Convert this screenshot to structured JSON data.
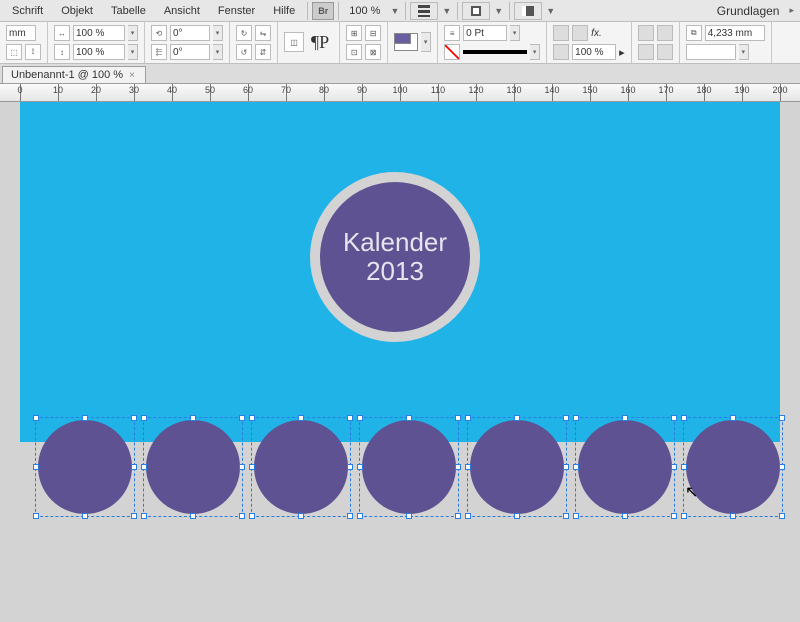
{
  "menu": {
    "items": [
      "Schrift",
      "Objekt",
      "Tabelle",
      "Ansicht",
      "Fenster",
      "Hilfe"
    ],
    "br": "Br",
    "zoom": "100 %",
    "workspace": "Grundlagen"
  },
  "opts": {
    "mm": "mm",
    "pct1": "100 %",
    "pct2": "100 %",
    "deg1": "0°",
    "deg2": "0°",
    "pt": "0 Pt",
    "pct3": "100 %",
    "dim": "4,233 mm",
    "fx": "fx."
  },
  "tab": {
    "title": "Unbenannt-1 @ 100 %"
  },
  "ruler": {
    "labels": [
      "0",
      "10",
      "20",
      "30",
      "40",
      "50",
      "60",
      "70",
      "80",
      "90",
      "100",
      "110",
      "120",
      "130",
      "140",
      "150",
      "160",
      "170",
      "180",
      "190",
      "200"
    ]
  },
  "art": {
    "title_l1": "Kalender",
    "title_l2": "2013"
  },
  "colors": {
    "cyan": "#1fb3e8",
    "purple": "#5e5292",
    "ring": "#d3d3d3"
  }
}
